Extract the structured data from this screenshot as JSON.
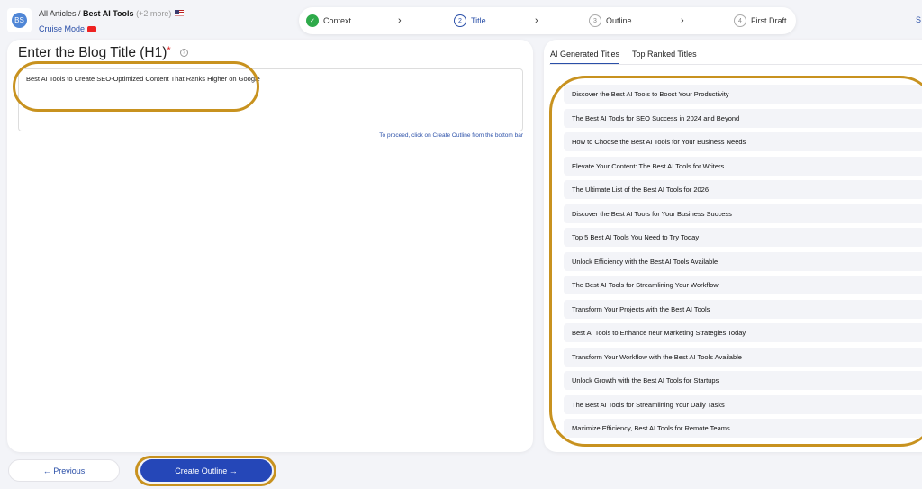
{
  "header": {
    "logo_initials": "BS",
    "breadcrumb_root": "All Articles /",
    "breadcrumb_current": "Best AI Tools",
    "breadcrumb_more": "(+2 more)",
    "cruise_mode": "Cruise Mode",
    "right_cut": "S"
  },
  "stepper": [
    {
      "num": "✓",
      "label": "Context",
      "state": "done"
    },
    {
      "num": "2",
      "label": "Title",
      "state": "active"
    },
    {
      "num": "3",
      "label": "Outline",
      "state": "todo"
    },
    {
      "num": "4",
      "label": "First Draft",
      "state": "todo"
    }
  ],
  "left": {
    "heading": "Enter the Blog Title (H1)",
    "required": "*",
    "help": "?",
    "title_value": "Best AI Tools to Create SEO-Optimized Content That Ranks Higher on Google",
    "hint": "To proceed, click on Create Outline from the bottom bar"
  },
  "right": {
    "tabs": [
      "AI Generated Titles",
      "Top Ranked Titles"
    ],
    "titles": [
      "Discover the Best AI Tools to Boost Your Productivity",
      "The Best AI Tools for SEO Success in 2024 and Beyond",
      "How to Choose the Best AI Tools for Your Business Needs",
      "Elevate Your Content: The Best AI Tools for Writers",
      "The Ultimate List of the Best AI Tools for 2026",
      "Discover the Best AI Tools for Your Business Success",
      "Top 5 Best AI Tools You Need to Try Today",
      "Unlock Efficiency with the Best AI Tools Available",
      "The Best AI Tools for Streamlining Your Workflow",
      "Transform Your Projects with the Best AI Tools",
      "Best AI Tools to Enhance neur Marketing Strategies Today",
      "Transform Your Workflow with the Best AI Tools Available",
      "Unlock Growth with the Best AI Tools for Startups",
      "The Best AI Tools for Streamlining Your Daily Tasks",
      "Maximize Efficiency, Best AI Tools for Remote Teams"
    ]
  },
  "footer": {
    "previous": "← Previous",
    "create": "Create Outline →"
  },
  "colors": {
    "accent": "#2547b8",
    "highlight": "#c8921f",
    "success": "#2eaa4a"
  }
}
